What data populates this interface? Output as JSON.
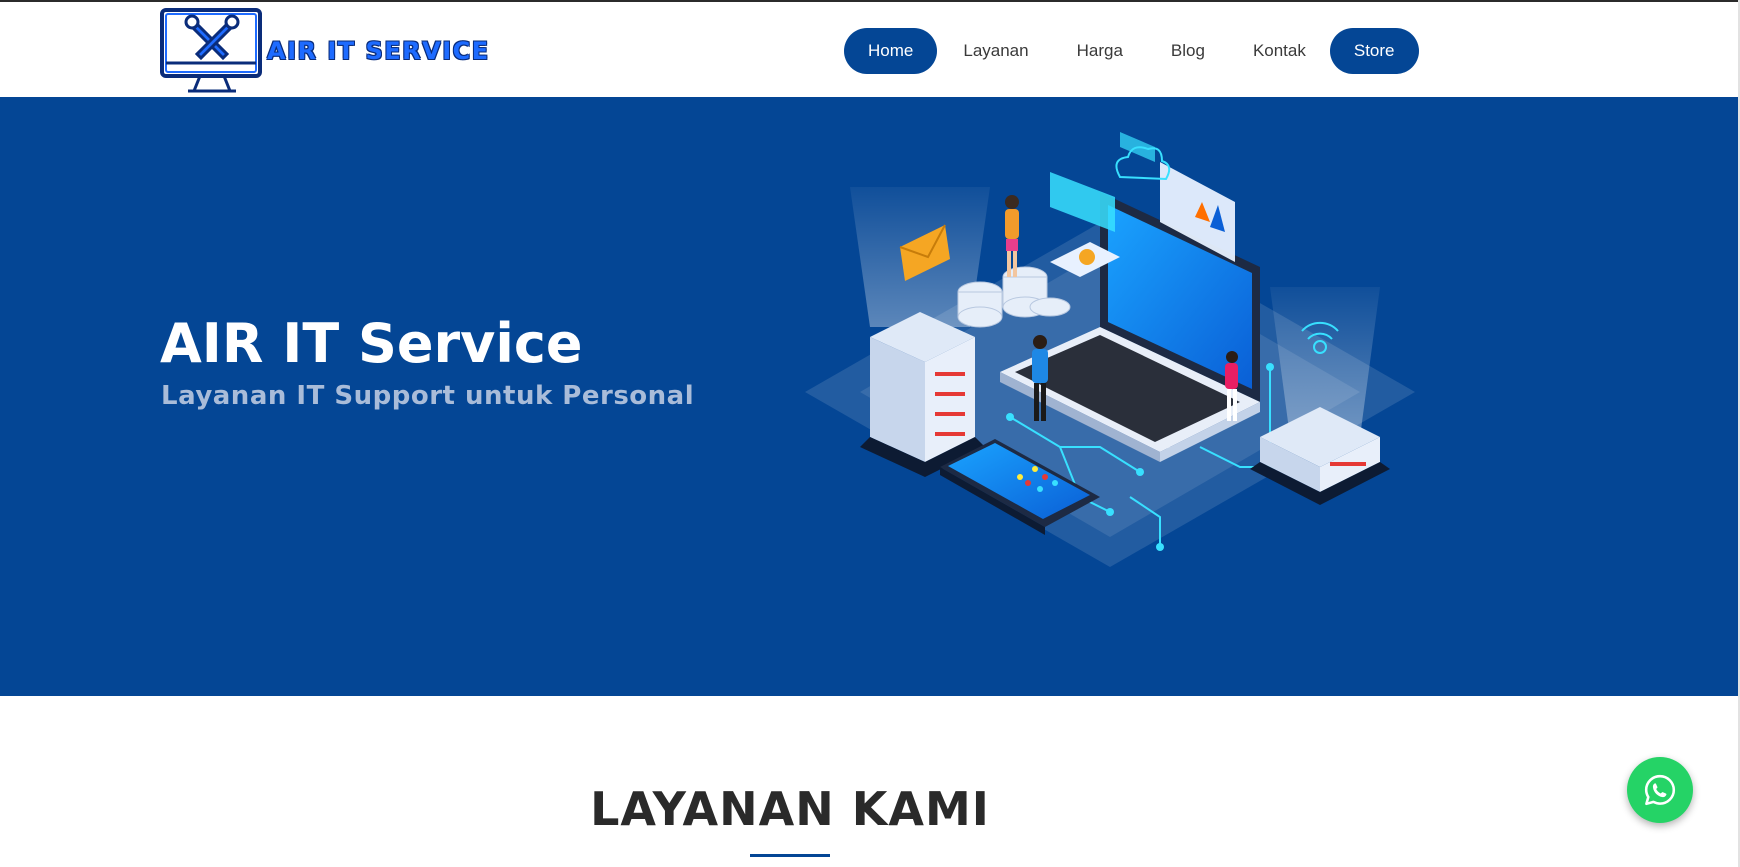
{
  "brand": {
    "logo_text": "AIR IT SERVICE"
  },
  "nav": {
    "items": [
      {
        "label": "Home",
        "active": true
      },
      {
        "label": "Layanan",
        "active": false
      },
      {
        "label": "Harga",
        "active": false
      },
      {
        "label": "Blog",
        "active": false
      },
      {
        "label": "Kontak",
        "active": false
      },
      {
        "label": "Store",
        "active": false
      }
    ]
  },
  "hero": {
    "title": "AIR IT Service",
    "subtitle": "Layanan IT Support untuk Personal"
  },
  "section": {
    "title": "LAYANAN KAMI"
  },
  "floating": {
    "whatsapp_icon": "whatsapp-icon"
  },
  "colors": {
    "primary": "#044695",
    "whatsapp": "#25D366",
    "logo_blue": "#1E6BFF",
    "subtitle": "#A9BCD9"
  }
}
